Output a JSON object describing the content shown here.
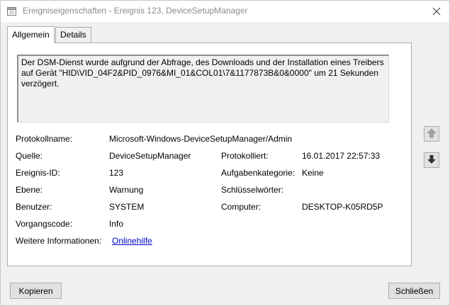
{
  "window": {
    "title": "Ereigniseigenschaften - Ereignis 123, DeviceSetupManager",
    "icon": "event-viewer-icon",
    "close_icon": "close-icon"
  },
  "tabs": [
    {
      "label": "Allgemein",
      "active": true
    },
    {
      "label": "Details",
      "active": false
    }
  ],
  "description": "Der DSM-Dienst wurde aufgrund der Abfrage, des Downloads und der Installation eines Treibers\nauf Gerät \"HID\\VID_04F2&PID_0976&MI_01&COL01\\7&1177873B&0&0000\" um 21 Sekunden\nverzögert.",
  "fields": {
    "protokollname": {
      "label": "Protokollname:",
      "value": "Microsoft-Windows-DeviceSetupManager/Admin"
    },
    "quelle": {
      "label": "Quelle:",
      "value": "DeviceSetupManager"
    },
    "protokolliert": {
      "label": "Protokolliert:",
      "value": "16.01.2017 22:57:33"
    },
    "ereignis_id": {
      "label": "Ereignis-ID:",
      "value": "123"
    },
    "aufgabenkategorie": {
      "label": "Aufgabenkategorie:",
      "value": "Keine"
    },
    "ebene": {
      "label": "Ebene:",
      "value": "Warnung"
    },
    "schluesselwoerter": {
      "label": "Schlüsselwörter:",
      "value": ""
    },
    "benutzer": {
      "label": "Benutzer:",
      "value": "SYSTEM"
    },
    "computer": {
      "label": "Computer:",
      "value": "DESKTOP-K05RD5P"
    },
    "vorgangscode": {
      "label": "Vorgangscode:",
      "value": "Info"
    },
    "weitere_informationen": {
      "label": "Weitere Informationen:",
      "value": "Onlinehilfe"
    }
  },
  "navigation": {
    "up_icon": "arrow-up-icon",
    "down_icon": "arrow-down-icon"
  },
  "buttons": {
    "copy": "Kopieren",
    "close": "Schließen"
  },
  "colors": {
    "link": "#0000cc",
    "title_text": "#8a8a8a",
    "dialog_bg": "#f0f0f0"
  }
}
